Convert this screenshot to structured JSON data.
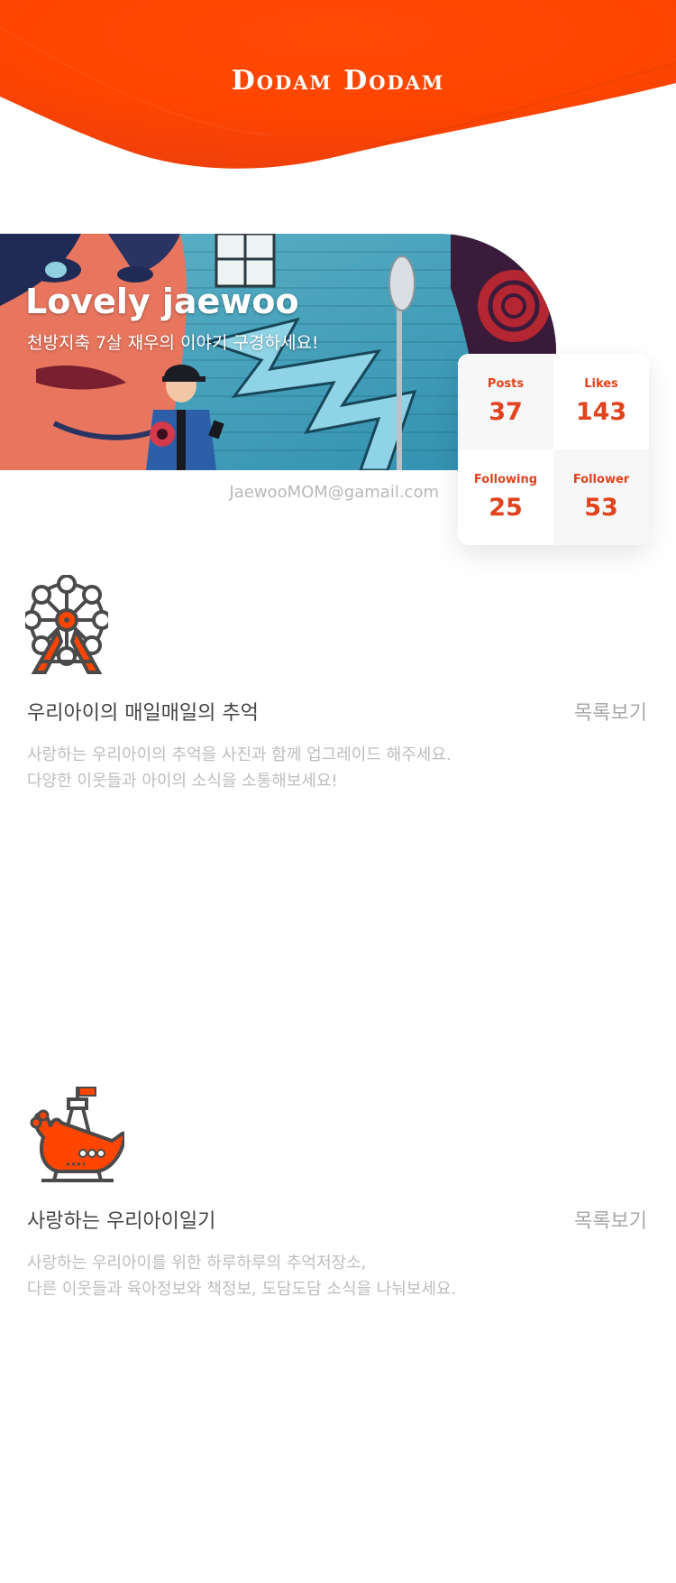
{
  "app": {
    "brand_title": "Dodam Dodam",
    "accent_color": "#ff4500"
  },
  "profile": {
    "title": "Lovely jaewoo",
    "subtitle": "천방지축 7살 재우의 이야기 구경하세요!",
    "email": "JaewooMOM@gamail.com"
  },
  "stats": [
    {
      "label": "Posts",
      "value": "37"
    },
    {
      "label": "Likes",
      "value": "143"
    },
    {
      "label": "Following",
      "value": "25"
    },
    {
      "label": "Follower",
      "value": "53"
    }
  ],
  "sections": [
    {
      "icon": "ferris-wheel-icon",
      "title": "우리아이의 매일매일의 추억",
      "link_label": "목록보기",
      "description_lines": [
        "사랑하는 우리아이의 추억을 사진과 함께 업그레이드 해주세요.",
        "다양한 이웃들과 아이의 소식을 소통해보세요!"
      ]
    },
    {
      "icon": "pirate-ship-ride-icon",
      "title": "사랑하는 우리아이일기",
      "link_label": "목록보기",
      "description_lines": [
        "사랑하는 우리아이를 위한 하루하루의 추억저장소,",
        "다른 이웃들과 육아정보와 책정보, 도담도담 소식을 나눠보세요."
      ]
    }
  ]
}
